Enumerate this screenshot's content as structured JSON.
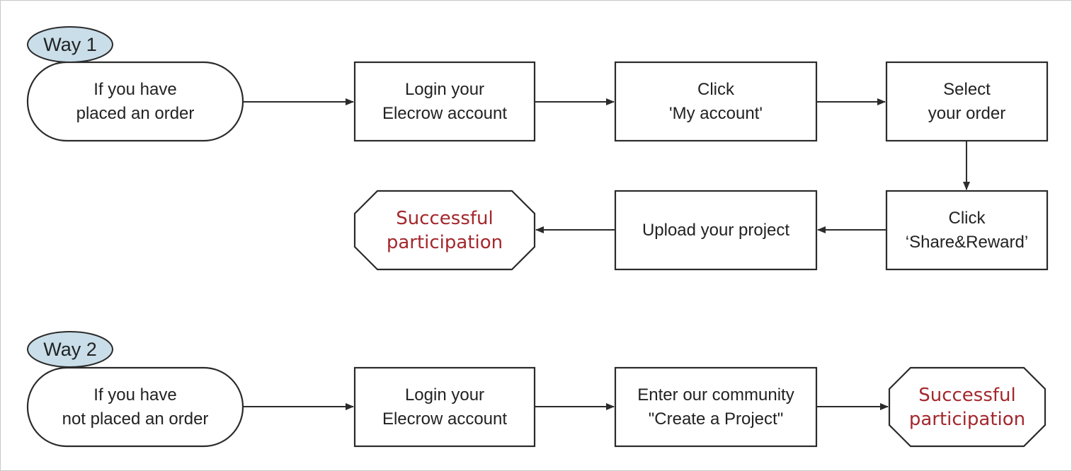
{
  "colors": {
    "stroke": "#2b2b2b",
    "label_fill": "#c9dee9",
    "success_text": "#a3282d"
  },
  "way1": {
    "label": "Way 1",
    "start": "If you have\nplaced an order",
    "steps": [
      "Login your\nElecrow account",
      "Click\n'My account'",
      "Select\nyour order",
      "Click\n‘Share&Reward’",
      "Upload your project"
    ],
    "end": "Successful\nparticipation"
  },
  "way2": {
    "label": "Way 2",
    "start": "If you have\nnot placed an order",
    "steps": [
      "Login your\nElecrow account",
      "Enter our community\n\"Create a Project\""
    ],
    "end": "Successful\nparticipation"
  }
}
